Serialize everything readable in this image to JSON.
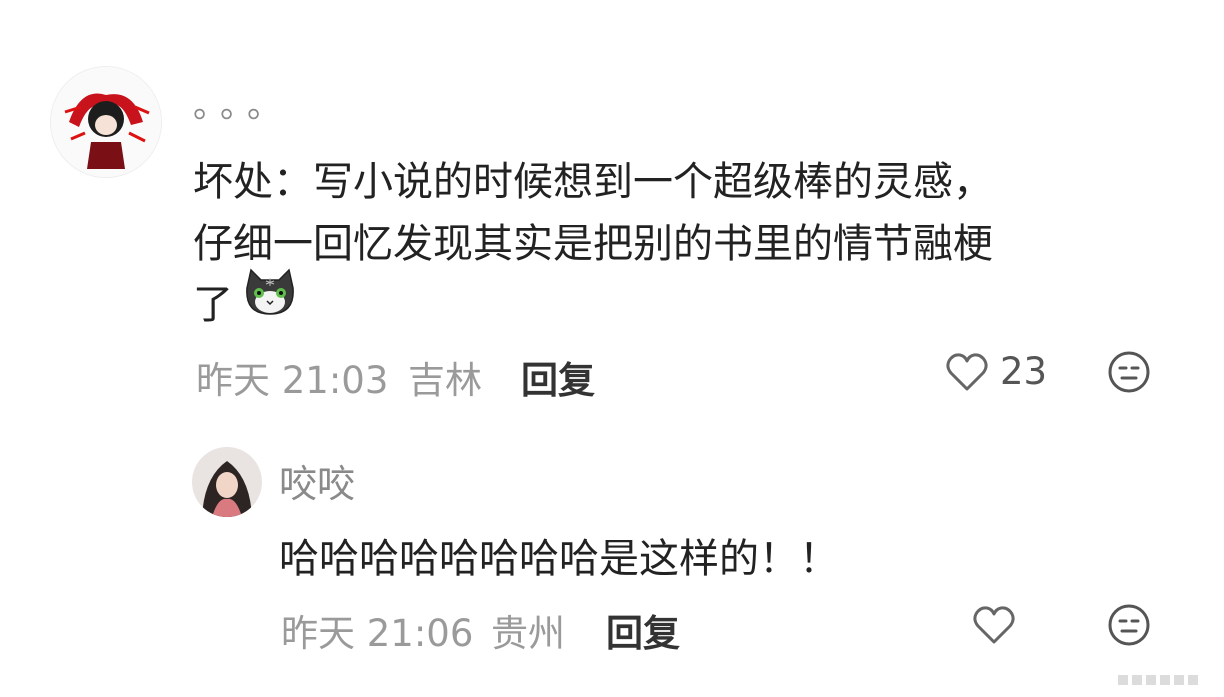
{
  "comment": {
    "username": "。。。",
    "text_line1": "坏处：写小说的时候想到一个超级棒的灵感，",
    "text_line2": "仔细一回忆发现其实是把别的书里的情节融梗",
    "text_line3": "了",
    "emoji": "cat-emoji",
    "time": "昨天 21:03",
    "location": "吉林",
    "reply_label": "回复",
    "like_count": "23"
  },
  "reply": {
    "username": "咬咬",
    "text": "哈哈哈哈哈哈哈哈是这样的！！",
    "time": "昨天 21:06",
    "location": "贵州",
    "reply_label": "回复"
  },
  "icons": {
    "like": "heart-outline-icon",
    "reaction": "neutral-face-icon"
  }
}
